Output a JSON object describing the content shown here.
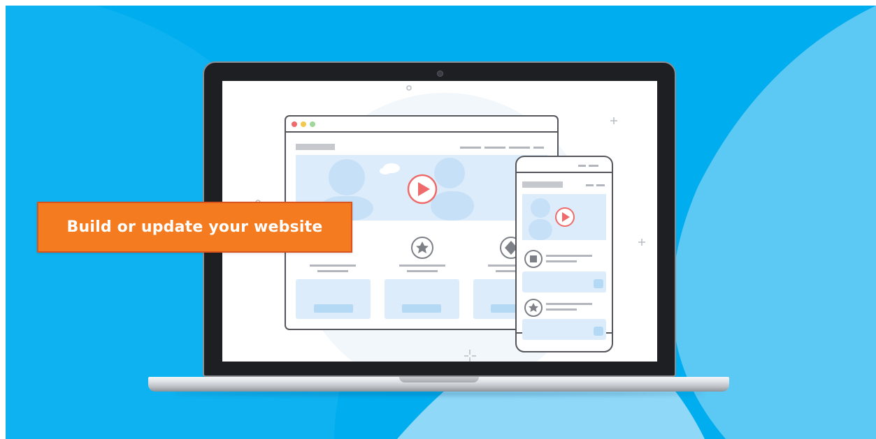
{
  "banner": {
    "text": "Build or update your website"
  },
  "colors": {
    "background": "#00aeef",
    "banner": "#f47b20",
    "banner_border": "#d9531e",
    "illustration_line": "#54565b",
    "illustration_fill": "#dcecfb",
    "play_accent": "#ef6b6b"
  },
  "illustration": {
    "browser_dots": [
      "#ef6b6b",
      "#f2c94c",
      "#9fd69a"
    ],
    "desktop_feature_icons": [
      "star-icon",
      "star-icon",
      "diamond-icon"
    ],
    "mobile_feature_icons": [
      "square-icon",
      "star-icon"
    ]
  }
}
